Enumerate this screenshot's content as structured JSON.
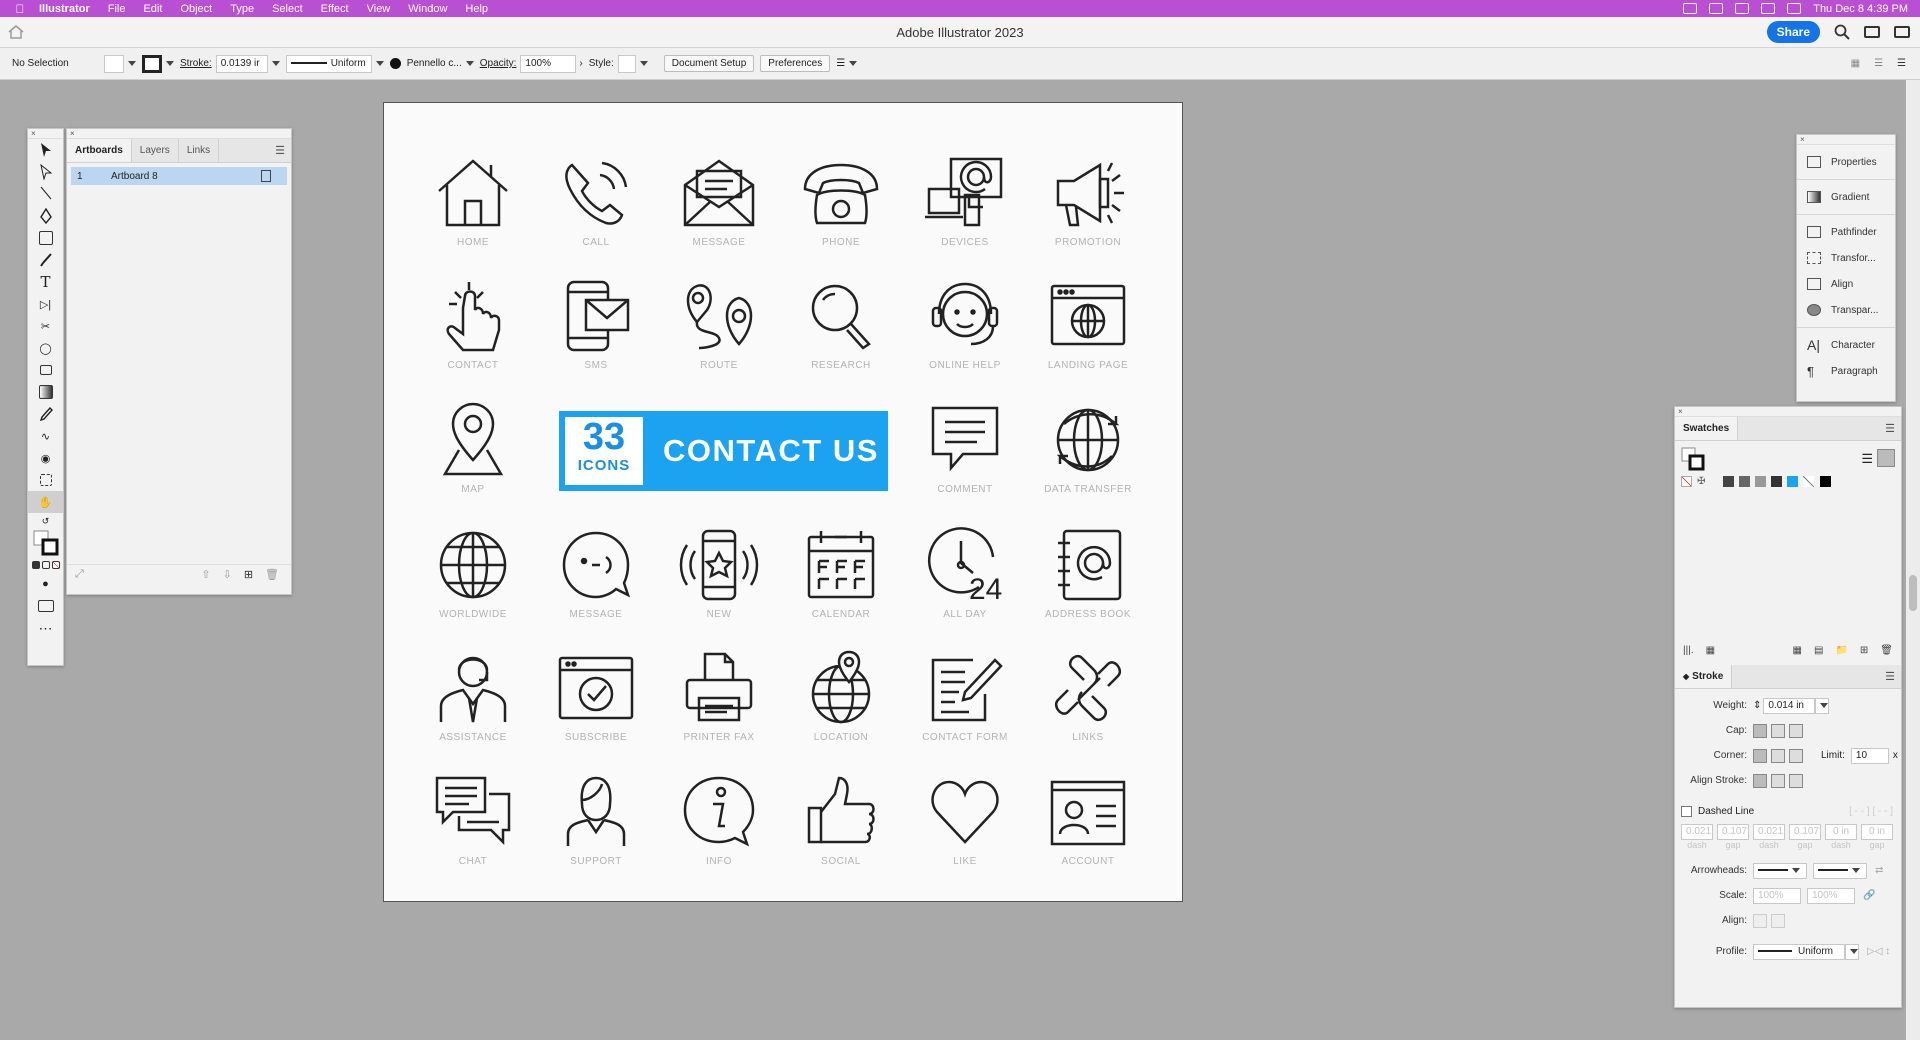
{
  "menubar": {
    "app": "Illustrator",
    "items": [
      "File",
      "Edit",
      "Object",
      "Type",
      "Select",
      "Effect",
      "View",
      "Window",
      "Help"
    ],
    "datetime": "Thu Dec 8  4:39 PM"
  },
  "titlebar": {
    "title": "Adobe Illustrator 2023",
    "share_label": "Share"
  },
  "controlbar": {
    "selection": "No Selection",
    "stroke_label": "Stroke:",
    "stroke_value": "0.0139 ir",
    "profile": "Uniform",
    "brush": "Pennello c...",
    "opacity_label": "Opacity:",
    "opacity_value": "100%",
    "style_label": "Style:",
    "document_setup": "Document Setup",
    "preferences": "Preferences"
  },
  "artboards_panel": {
    "tabs": [
      "Artboards",
      "Layers",
      "Links"
    ],
    "rows": [
      {
        "num": "1",
        "name": "Artboard 8"
      }
    ]
  },
  "artboard": {
    "banner": {
      "number": "33",
      "sub": "ICONS",
      "title": "CONTACT US"
    },
    "labels": {
      "home": "HOME",
      "call": "CALL",
      "message": "MESSAGE",
      "phone": "PHONE",
      "devices": "DEVICES",
      "promotion": "PROMOTION",
      "contact": "CONTACT",
      "sms": "SMS",
      "route": "ROUTE",
      "research": "RESEARCH",
      "online_help": "ONLINE HELP",
      "landing_page": "LANDING PAGE",
      "map": "MAP",
      "comment": "COMMENT",
      "data_transfer": "DATA TRANSFER",
      "worldwide": "WORLDWIDE",
      "message2": "MESSAGE",
      "new": "NEW",
      "calendar": "CALENDAR",
      "all_day": "ALL DAY",
      "address_book": "ADDRESS BOOK",
      "assistance": "ASSISTANCE",
      "subscribe": "SUBSCRIBE",
      "printer_fax": "PRINTER FAX",
      "location": "LOCATION",
      "contact_form": "CONTACT FORM",
      "links": "LINKS",
      "chat": "CHAT",
      "support": "SUPPORT",
      "info": "INFO",
      "social": "SOCIAL",
      "like": "LIKE",
      "account": "ACCOUNT"
    },
    "all_day_number": "24"
  },
  "dock": {
    "group1": [
      "Properties",
      "Gradient"
    ],
    "group2": [
      "Pathfinder",
      "Transfor...",
      "Align",
      "Transpar..."
    ],
    "group3": [
      "Character",
      "Paragraph"
    ]
  },
  "swatches_panel": {
    "tab": "Swatches",
    "stroke_tab": "Stroke",
    "weight_label": "Weight:",
    "weight_value": "0.014 in",
    "cap_label": "Cap:",
    "corner_label": "Corner:",
    "limit_label": "Limit:",
    "limit_value": "10",
    "limit_unit": "x",
    "align_label": "Align Stroke:",
    "dashed_label": "Dashed Line",
    "dash_values": [
      "0.021",
      "0.107",
      "0.021",
      "0.107",
      "0 in",
      "0 in"
    ],
    "dash_labels": [
      "dash",
      "gap",
      "dash",
      "gap",
      "dash",
      "gap"
    ],
    "arrowheads_label": "Arrowheads:",
    "scale_label": "Scale:",
    "scale_values": [
      "100%",
      "100%"
    ],
    "align2_label": "Align:",
    "profile_label": "Profile:",
    "profile_value": "Uniform"
  },
  "colors": {
    "menubar": "#b94fd2",
    "banner": "#1ba2f0",
    "share": "#1473e6"
  }
}
